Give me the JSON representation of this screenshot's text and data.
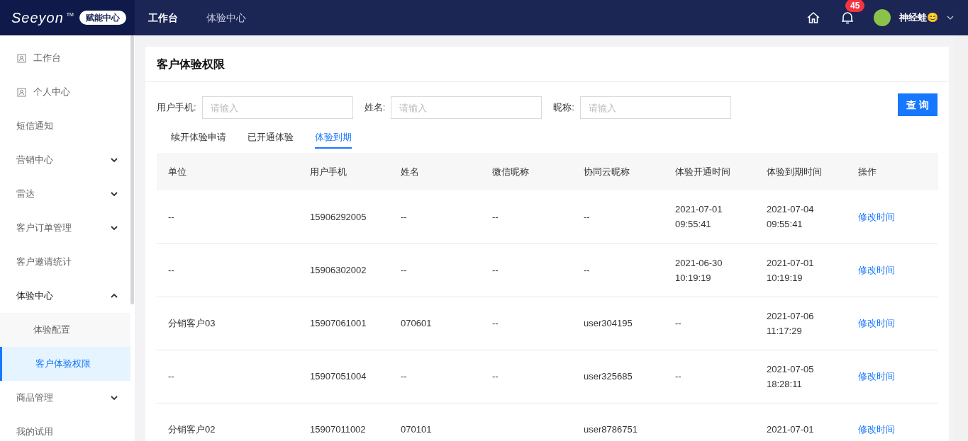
{
  "topbar": {
    "logo": "Seeyon",
    "trademark": "TM",
    "badge": "赋能中心",
    "nav": [
      {
        "label": "工作台",
        "selected": true
      },
      {
        "label": "体验中心",
        "selected": false
      }
    ],
    "notification_count": "45",
    "user_name": "神经蛙😊"
  },
  "sidebar": {
    "items": [
      {
        "label": "工作台",
        "kind": "icon",
        "expanded": false,
        "selected": false
      },
      {
        "label": "个人中心",
        "kind": "icon",
        "expanded": false,
        "selected": false
      },
      {
        "label": "短信通知",
        "kind": "plain",
        "expanded": false,
        "selected": false
      },
      {
        "label": "营销中心",
        "kind": "group",
        "expanded": false,
        "selected": false
      },
      {
        "label": "雷达",
        "kind": "group",
        "expanded": false,
        "selected": false
      },
      {
        "label": "客户订单管理",
        "kind": "group",
        "expanded": false,
        "selected": false
      },
      {
        "label": "客户邀请统计",
        "kind": "plain",
        "expanded": false,
        "selected": false
      },
      {
        "label": "体验中心",
        "kind": "group",
        "expanded": true,
        "selected": false,
        "children": [
          {
            "label": "体验配置",
            "selected": false
          },
          {
            "label": "客户体验权限",
            "selected": true
          }
        ]
      },
      {
        "label": "商品管理",
        "kind": "group",
        "expanded": false,
        "selected": false
      },
      {
        "label": "我的试用",
        "kind": "plain",
        "expanded": false,
        "selected": false
      }
    ]
  },
  "page": {
    "title": "客户体验权限",
    "filters": [
      {
        "label": "用户手机:",
        "placeholder": "请输入"
      },
      {
        "label": "姓名:",
        "placeholder": "请输入"
      },
      {
        "label": "昵称:",
        "placeholder": "请输入"
      }
    ],
    "search_button": "查 询",
    "tabs": [
      {
        "label": "续开体验申请",
        "selected": false
      },
      {
        "label": "已开通体验",
        "selected": false
      },
      {
        "label": "体验到期",
        "selected": true
      }
    ],
    "table": {
      "columns": [
        "单位",
        "用户手机",
        "姓名",
        "微信昵称",
        "协同云昵称",
        "体验开通时间",
        "体验到期时间",
        "操作"
      ],
      "rows": [
        [
          "--",
          "15906292005",
          "--",
          "--",
          "--",
          "2021-07-01\n09:55:41",
          "2021-07-04\n09:55:41",
          "修改时间"
        ],
        [
          "--",
          "15906302002",
          "--",
          "--",
          "--",
          "2021-06-30\n10:19:19",
          "2021-07-01\n10:19:19",
          "修改时间"
        ],
        [
          "分销客户03",
          "15907061001",
          "070601",
          "--",
          "user304195",
          "--",
          "2021-07-06\n11:17:29",
          "修改时间"
        ],
        [
          "--",
          "15907051004",
          "--",
          "--",
          "user325685",
          "--",
          "2021-07-05\n18:28:11",
          "修改时间"
        ],
        [
          "分销客户02",
          "15907011002",
          "070101",
          "",
          "user8786751",
          "",
          "2021-07-01",
          "修改时间"
        ]
      ]
    }
  }
}
